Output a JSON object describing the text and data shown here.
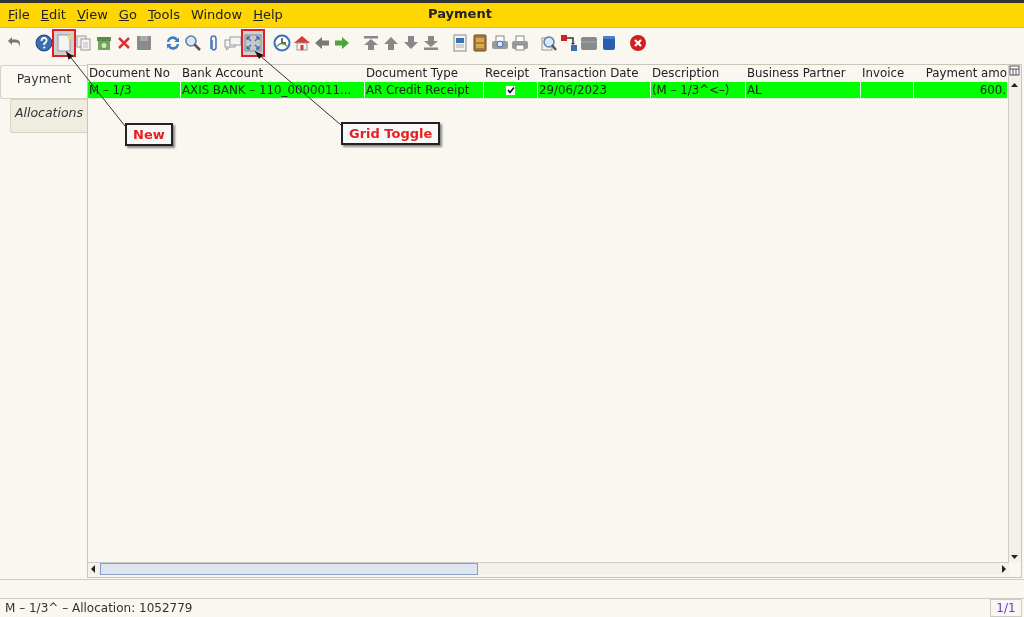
{
  "menu": [
    {
      "label": "File",
      "mnemonic": true
    },
    {
      "label": "Edit",
      "mnemonic": true
    },
    {
      "label": "View",
      "mnemonic": true
    },
    {
      "label": "Go",
      "mnemonic": true
    },
    {
      "label": "Tools",
      "mnemonic": true
    },
    {
      "label": "Window",
      "mnemonic": false
    },
    {
      "label": "Help",
      "mnemonic": true
    }
  ],
  "window": {
    "title": "Payment"
  },
  "toolbar": [
    {
      "kind": "undo"
    },
    {
      "kind": "help"
    },
    {
      "kind": "new",
      "callout": "New"
    },
    {
      "kind": "copy"
    },
    {
      "kind": "archive"
    },
    {
      "kind": "delete"
    },
    {
      "kind": "save"
    },
    {
      "kind": "refresh"
    },
    {
      "kind": "find"
    },
    {
      "kind": "attach"
    },
    {
      "kind": "chat"
    },
    {
      "kind": "grid",
      "callout": "Grid Toggle"
    },
    {
      "kind": "history"
    },
    {
      "kind": "home"
    },
    {
      "kind": "back"
    },
    {
      "kind": "forward"
    },
    {
      "kind": "first"
    },
    {
      "kind": "up"
    },
    {
      "kind": "down"
    },
    {
      "kind": "last"
    },
    {
      "kind": "report"
    },
    {
      "kind": "folder"
    },
    {
      "kind": "preview"
    },
    {
      "kind": "print"
    },
    {
      "kind": "zoom"
    },
    {
      "kind": "workflow"
    },
    {
      "kind": "product"
    },
    {
      "kind": "block"
    },
    {
      "kind": "exit"
    }
  ],
  "tabs": [
    {
      "label": "Payment",
      "selected": true
    },
    {
      "label": "Allocations",
      "selected": false
    }
  ],
  "table": {
    "columns": [
      {
        "label": "Document No",
        "kind": "text"
      },
      {
        "label": "Bank Account",
        "kind": "text"
      },
      {
        "label": "Document Type",
        "kind": "text"
      },
      {
        "label": "Receipt",
        "kind": "check"
      },
      {
        "label": "Transaction Date",
        "kind": "text"
      },
      {
        "label": "Description",
        "kind": "text"
      },
      {
        "label": "Business Partner",
        "kind": "text"
      },
      {
        "label": "Invoice",
        "kind": "text"
      },
      {
        "label": "Payment amo",
        "kind": "amount"
      }
    ],
    "rows": [
      {
        "selected": true,
        "cells": [
          {
            "text": "M – 1/3"
          },
          {
            "text": "AXIS BANK – 110_0000011..."
          },
          {
            "text": "AR Credit Receipt"
          },
          {
            "checked": true
          },
          {
            "text": "29/06/2023"
          },
          {
            "text": "(M – 1/3^<–)"
          },
          {
            "text": "AL"
          },
          {},
          {
            "text": "600."
          }
        ]
      }
    ]
  },
  "status_bar": {
    "message": "M – 1/3^ – Allocation: 1052779",
    "record": "1/1"
  }
}
